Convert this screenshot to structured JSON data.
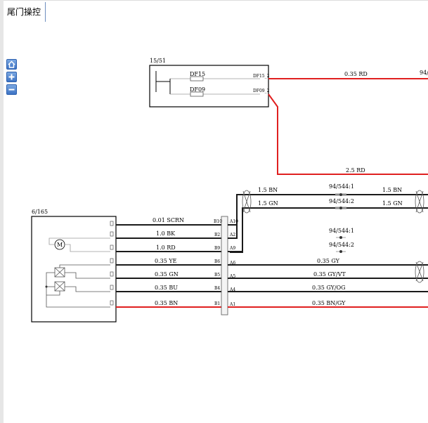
{
  "tab": {
    "title": "尾门操控"
  },
  "toolbar": [
    {
      "name": "home-button",
      "icon": "home-icon"
    },
    {
      "name": "zoom-in-button",
      "icon": "plus-icon"
    },
    {
      "name": "zoom-out-button",
      "icon": "minus-icon"
    }
  ],
  "colors": {
    "red_wire": "#e02020",
    "black_wire": "#1a1a1a",
    "gray_wire": "#9a9a9a"
  },
  "fuse_box": {
    "id": "15/51",
    "fuses": [
      "DF15",
      "DF09"
    ],
    "pins": [
      "DF15_2",
      "DF09_2"
    ]
  },
  "module": {
    "id": "6/165",
    "motor_symbol": "M"
  },
  "connector": {
    "left_pins": [
      "B10",
      "B2",
      "B9",
      "B6",
      "B5",
      "B4",
      "B1"
    ],
    "right_pins": [
      "A10",
      "A2",
      "A9",
      "A6",
      "A5",
      "A4",
      "A1"
    ]
  },
  "wires": {
    "fuse_out": "0.35 RD",
    "fuse_ref_cut": "94/",
    "feed": "2.5 RD",
    "upper_left": "1.5 BN",
    "upper_right": "1.5 BN",
    "lower_left": "1.5 GN",
    "lower_right": "1.5 GN",
    "splice1": "94/544:1",
    "splice2": "94/544:2",
    "splice3": "94/544:1",
    "splice4": "94/544:2",
    "m_scrn": "0.01 SCRN",
    "m_bk": "1.0 BK",
    "m_rd": "1.0 RD",
    "m_ye": "0.35 YE",
    "m_gn": "0.35 GN",
    "m_bu": "0.35 BU",
    "m_bn": "0.35 BN",
    "r_gy": "0.35 GY",
    "r_gyvt": "0.35 GY/VT",
    "r_gyog": "0.35 GY/OG",
    "r_bngy": "0.35 BN/GY"
  }
}
